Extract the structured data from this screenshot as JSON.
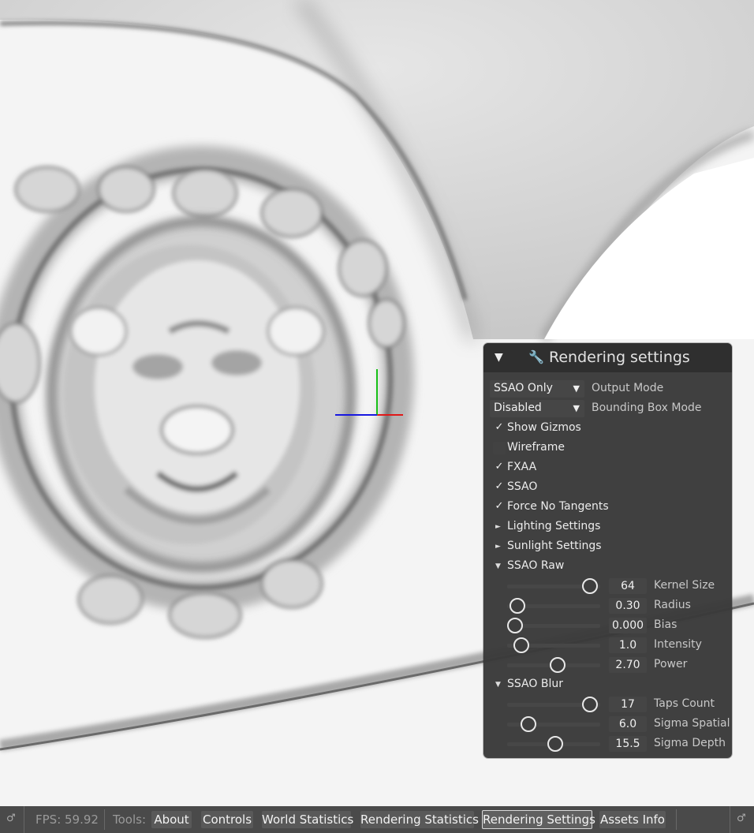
{
  "panel": {
    "title": "Rendering settings",
    "collapse_glyph": "▼",
    "wrench_glyph": "🔧",
    "output_mode": {
      "value": "SSAO Only",
      "label": "Output Mode"
    },
    "bounding_box_mode": {
      "value": "Disabled",
      "label": "Bounding Box Mode"
    },
    "checkboxes": [
      {
        "label": "Show Gizmos",
        "checked": true
      },
      {
        "label": "Wireframe",
        "checked": false
      },
      {
        "label": "FXAA",
        "checked": true
      },
      {
        "label": "SSAO",
        "checked": true
      },
      {
        "label": "Force No Tangents",
        "checked": true
      }
    ],
    "check_glyph": "✓",
    "tree": {
      "lighting": "Lighting Settings",
      "sunlight": "Sunlight Settings",
      "ssao_raw": "SSAO Raw",
      "ssao_blur": "SSAO Blur",
      "collapsed_glyph": "►",
      "expanded_glyph": "▼"
    },
    "ssao_raw_sliders": [
      {
        "label": "Kernel Size",
        "value": "64",
        "fraction": 0.93
      },
      {
        "label": "Radius",
        "value": "0.30",
        "fraction": 0.03
      },
      {
        "label": "Bias",
        "value": "0.000",
        "fraction": 0.0
      },
      {
        "label": "Intensity",
        "value": "1.0",
        "fraction": 0.08
      },
      {
        "label": "Power",
        "value": "2.70",
        "fraction": 0.53
      }
    ],
    "ssao_blur_sliders": [
      {
        "label": "Taps Count",
        "value": "17",
        "fraction": 0.93
      },
      {
        "label": "Sigma Spatial",
        "value": "6.0",
        "fraction": 0.17
      },
      {
        "label": "Sigma Depth",
        "value": "15.5",
        "fraction": 0.5
      }
    ]
  },
  "statusbar": {
    "fps": "FPS: 59.92",
    "tools_label": "Tools:",
    "buttons": [
      "About",
      "Controls",
      "World Statistics",
      "Rendering Statistics",
      "Rendering Settings",
      "Assets Info"
    ],
    "active_button": "Rendering Settings",
    "edge_glyph": "♂"
  },
  "colors": {
    "gizmo_x": "#e01818",
    "gizmo_y": "#18c018",
    "gizmo_z": "#1818e0",
    "panel_bg": "#3a3a3a",
    "statusbar_bg": "#4a4a4a"
  }
}
